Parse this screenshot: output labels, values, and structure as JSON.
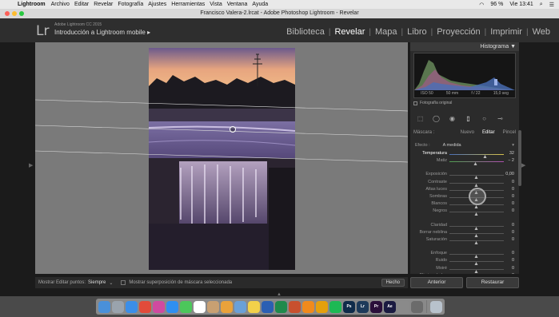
{
  "menubar": {
    "app": "Lightroom",
    "items": [
      "Archivo",
      "Editar",
      "Revelar",
      "Fotografía",
      "Ajustes",
      "Herramientas",
      "Vista",
      "Ventana",
      "Ayuda"
    ],
    "battery": "96 %",
    "clock": "Vie 13:41"
  },
  "window": {
    "title": "Francisco Valera-2.lrcat - Adobe Photoshop Lightroom - Revelar"
  },
  "identity": {
    "logo": "Lr",
    "version": "Adobe Lightroom CC 2015",
    "catalog": "Introducción a Lightroom mobile ▸"
  },
  "modules": [
    "Biblioteca",
    "Revelar",
    "Mapa",
    "Libro",
    "Proyección",
    "Imprimir",
    "Web"
  ],
  "active_module": "Revelar",
  "toolbar": {
    "show_pins_label": "Mostrar Editar puntos:",
    "show_pins_value": "Siempre",
    "overlay_label": "Mostrar superposición de máscara seleccionada",
    "done": "Hecho"
  },
  "panel": {
    "histogram_title": "Histograma ▼",
    "iso": "ISO 50",
    "focal": "50 mm",
    "aperture": "f / 22",
    "shutter": "15,0 seg",
    "original_photo": "Fotografía original",
    "mask_label": "Máscara :",
    "mask_new": "Nuevo",
    "mask_edit": "Editar",
    "mask_brush": "Pincel",
    "effect_label": "Efecto :",
    "effect_value": "A medida"
  },
  "adjustments": [
    {
      "name": "Temperatura",
      "value": "32",
      "pos": 0.66
    },
    {
      "name": "Matiz",
      "value": "− 2",
      "pos": 0.48
    },
    {
      "name": "Exposición",
      "value": "0,00",
      "pos": 0.5
    },
    {
      "name": "Contraste",
      "value": "0",
      "pos": 0.5
    },
    {
      "name": "Altas luces",
      "value": "0",
      "pos": 0.5
    },
    {
      "name": "Sombras",
      "value": "0",
      "pos": 0.5
    },
    {
      "name": "Blancos",
      "value": "0",
      "pos": 0.5
    },
    {
      "name": "Negros",
      "value": "0",
      "pos": 0.5
    },
    {
      "name": "Claridad",
      "value": "0",
      "pos": 0.5
    },
    {
      "name": "Borrar neblina",
      "value": "0",
      "pos": 0.5
    },
    {
      "name": "Saturación",
      "value": "0",
      "pos": 0.5
    },
    {
      "name": "Enfoque",
      "value": "0",
      "pos": 0.5
    },
    {
      "name": "Ruido",
      "value": "0",
      "pos": 0.5
    },
    {
      "name": "Moiré",
      "value": "0",
      "pos": 0.5
    },
    {
      "name": "Eliminar halos",
      "value": "0",
      "pos": 0.5
    }
  ],
  "bottom": {
    "previous": "Anterior",
    "reset": "Restaurar"
  },
  "dock": [
    "finder",
    "launchpad",
    "safari",
    "chrome",
    "itunes",
    "appstore",
    "messages",
    "calendar",
    "contacts",
    "photos",
    "preview",
    "notes",
    "word",
    "excel",
    "powerpoint",
    "vlc",
    "plex",
    "spotify",
    "photoshop",
    "lightroom",
    "premiere",
    "aftereffects",
    "settings",
    "dictionary",
    "trash"
  ]
}
